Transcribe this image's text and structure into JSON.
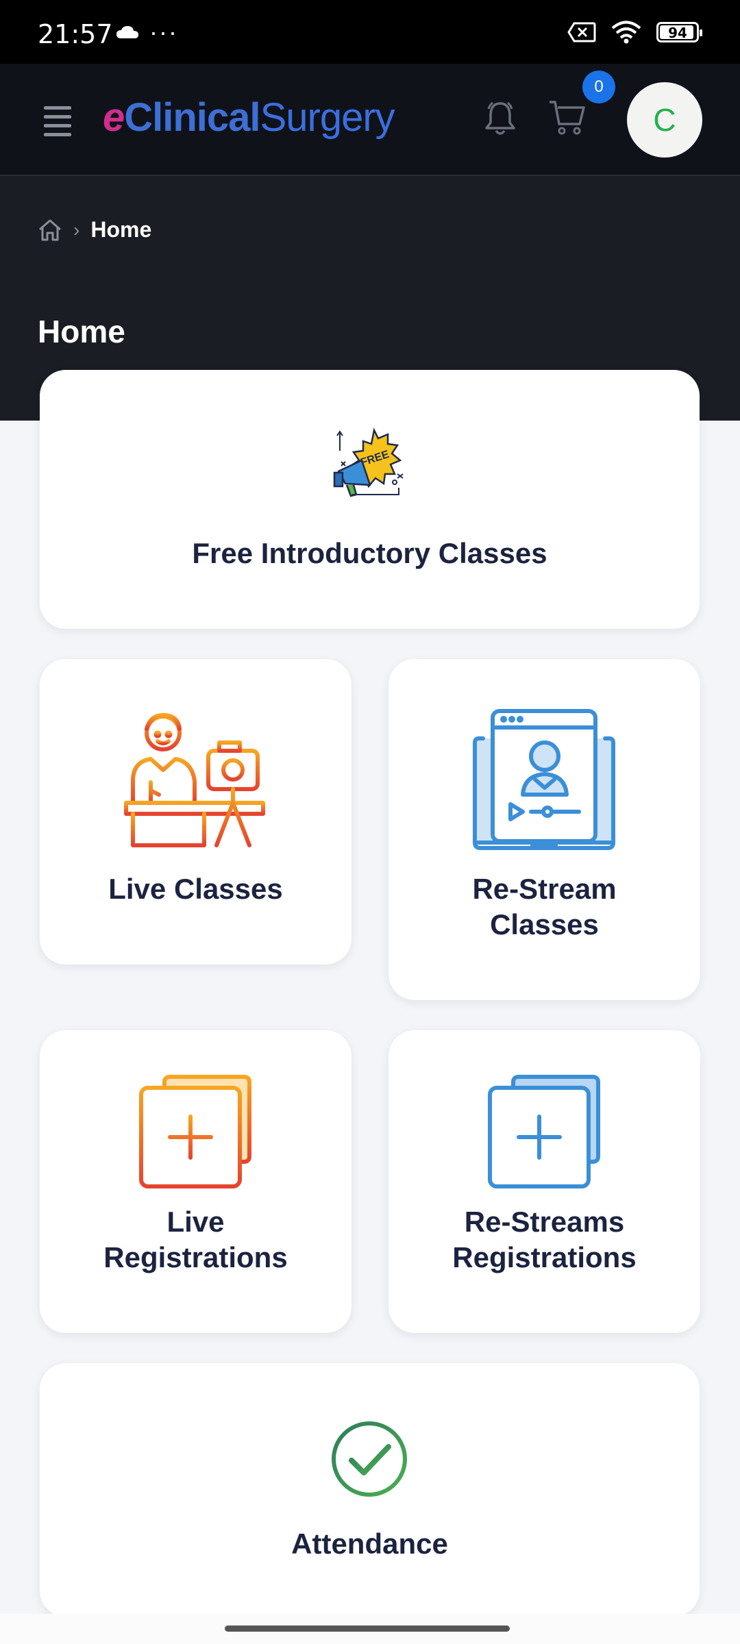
{
  "status_bar": {
    "time": "21:57",
    "dots": "···",
    "battery": "94"
  },
  "nav": {
    "brand_e": "e",
    "brand_clinical": "Clinical",
    "brand_surgery": "Surgery",
    "cart_count": "0",
    "avatar_initial": "C"
  },
  "breadcrumb": {
    "separator": "›",
    "current": "Home"
  },
  "page": {
    "title": "Home"
  },
  "cards": {
    "free": "Free Introductory Classes",
    "live": "Live Classes",
    "restream_line1": "Re-Stream",
    "restream_line2": "Classes",
    "live_reg_line1": "Live",
    "live_reg_line2": "Registrations",
    "restream_reg_line1": "Re-Streams",
    "restream_reg_line2": "Registrations",
    "attendance": "Attendance"
  },
  "icons": {
    "free": "megaphone-free-icon",
    "live": "presenter-camera-icon",
    "restream": "laptop-video-icon",
    "live_reg": "add-square-icon",
    "restream_reg": "add-square-icon",
    "attendance": "check-circle-icon"
  },
  "colors": {
    "dark_bg": "#1b1d24",
    "nav_bg": "#101219",
    "badge": "#1a73e8",
    "avatar_text": "#22b14c",
    "orange": "#ef7a2e",
    "blue": "#3b8fd8",
    "green": "#2e8b5a"
  }
}
